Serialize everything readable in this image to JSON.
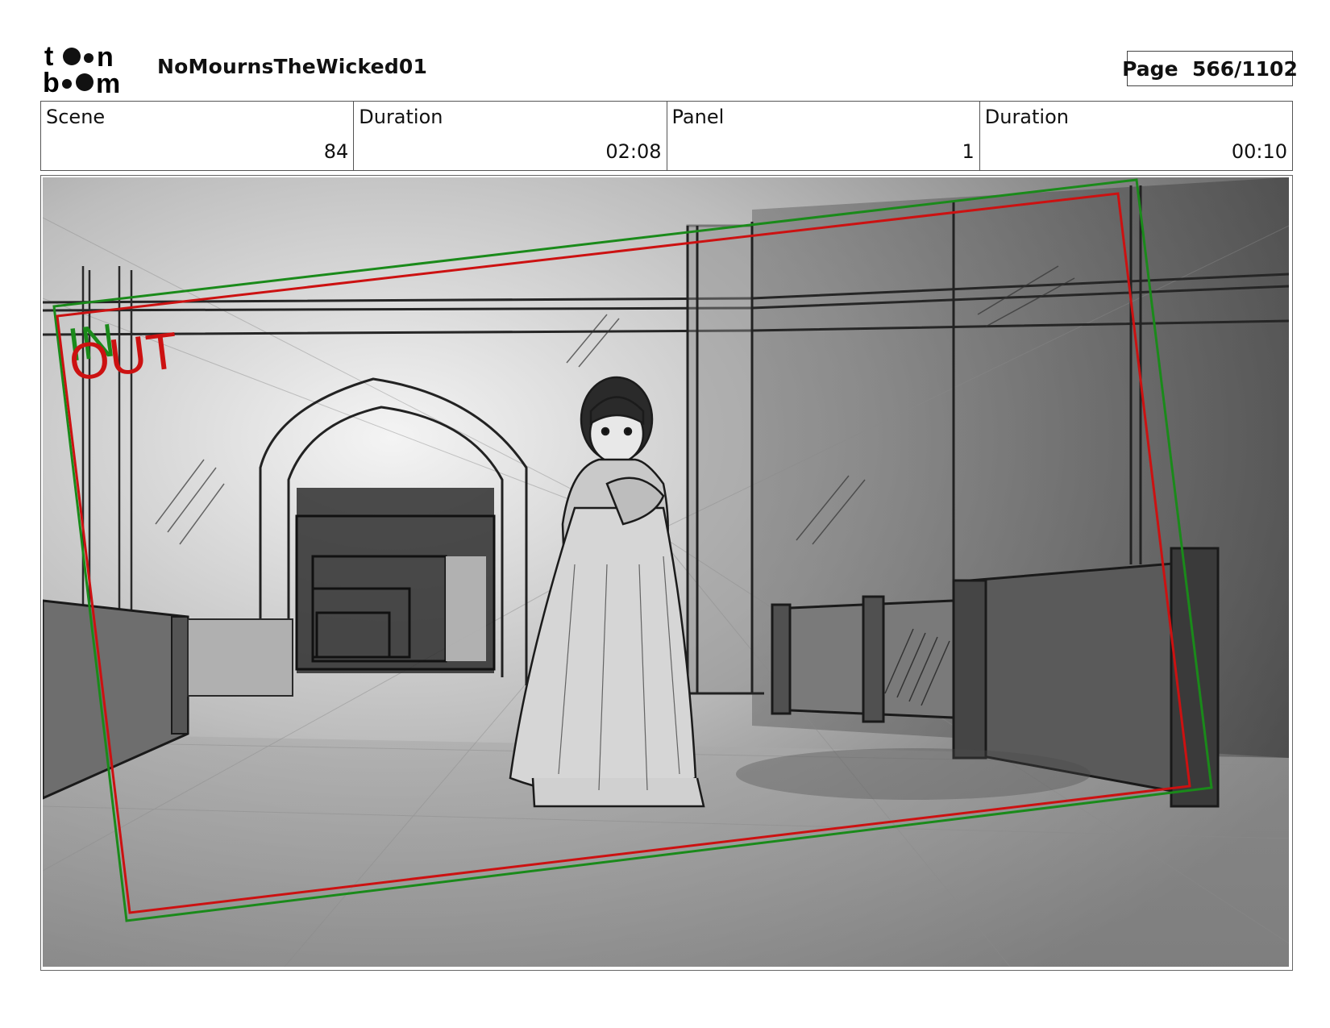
{
  "header": {
    "logo_text": "toonboom",
    "project_title": "NoMournsTheWicked01",
    "page_label": "Page",
    "page_value": "566/1102"
  },
  "info": [
    {
      "label": "Scene",
      "value": "84"
    },
    {
      "label": "Duration",
      "value": "02:08"
    },
    {
      "label": "Panel",
      "value": "1"
    },
    {
      "label": "Duration",
      "value": "00:10"
    }
  ],
  "panel": {
    "camera_in_label": "IN",
    "camera_out_label": "OUT",
    "colors": {
      "in_frame": "#1a8a1a",
      "out_frame": "#cc1111"
    }
  }
}
